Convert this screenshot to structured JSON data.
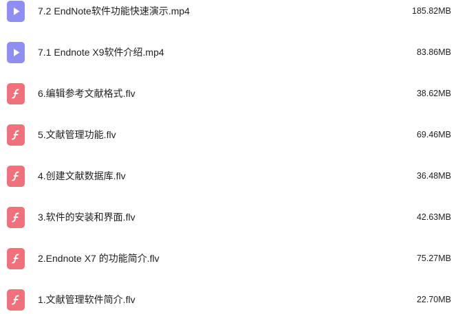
{
  "colors": {
    "video_icon": "#8e8ef3",
    "flash_icon": "#f0707b",
    "text": "#1f1f1f",
    "background": "#ffffff"
  },
  "files": [
    {
      "name": "7.2 EndNote软件功能快速演示.mp4",
      "size": "185.82MB",
      "icon": "video-play-icon"
    },
    {
      "name": "7.1 Endnote X9软件介绍.mp4",
      "size": "83.86MB",
      "icon": "video-play-icon"
    },
    {
      "name": "6.编辑参考文献格式.flv",
      "size": "38.62MB",
      "icon": "flash-file-icon"
    },
    {
      "name": "5.文献管理功能.flv",
      "size": "69.46MB",
      "icon": "flash-file-icon"
    },
    {
      "name": "4.创建文献数据库.flv",
      "size": "36.48MB",
      "icon": "flash-file-icon"
    },
    {
      "name": "3.软件的安装和界面.flv",
      "size": "42.63MB",
      "icon": "flash-file-icon"
    },
    {
      "name": "2.Endnote X7 的功能简介.flv",
      "size": "75.27MB",
      "icon": "flash-file-icon"
    },
    {
      "name": "1.文献管理软件简介.flv",
      "size": "22.70MB",
      "icon": "flash-file-icon"
    }
  ]
}
